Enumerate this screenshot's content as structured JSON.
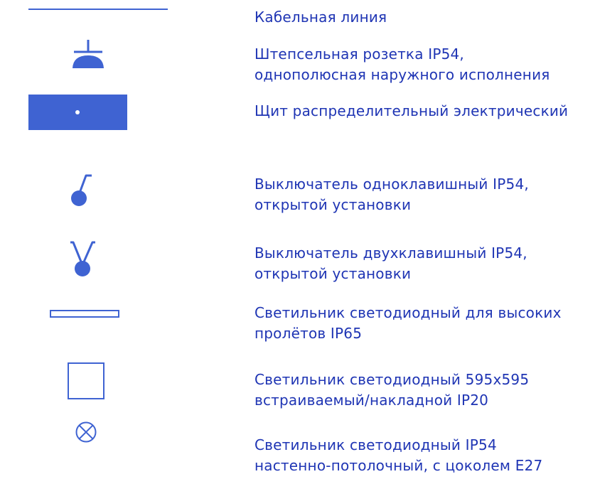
{
  "legend": {
    "colors": {
      "symbol": "#3f63d2",
      "text": "#1f35b4"
    },
    "items": [
      {
        "symbol": "cable-line",
        "lines": [
          "Кабельная линия"
        ]
      },
      {
        "symbol": "socket-ip54",
        "lines": [
          "Штепсельная розетка IP54,",
          "однополюсная наружного исполнения"
        ]
      },
      {
        "symbol": "distribution-panel",
        "lines": [
          "Щит распределительный электрический"
        ]
      },
      {
        "symbol": "single-key-switch",
        "lines": [
          "Выключатель одноклавишный IP54,",
          "открытой установки"
        ]
      },
      {
        "symbol": "double-key-switch",
        "lines": [
          "Выключатель двухклавишный IP54,",
          "открытой установки"
        ]
      },
      {
        "symbol": "high-bay-led-luminaire",
        "lines": [
          "Светильник светодиодный для высоких",
          "пролётов IP65"
        ]
      },
      {
        "symbol": "panel-led-luminaire",
        "lines": [
          "Светильник светодиодный 595х595",
          "встраиваемый/накладной IP20"
        ]
      },
      {
        "symbol": "wall-ceiling-led-luminaire",
        "lines": [
          "Светильник светодиодный IP54",
          "настенно-потолочный, с цоколем E27"
        ]
      }
    ]
  }
}
